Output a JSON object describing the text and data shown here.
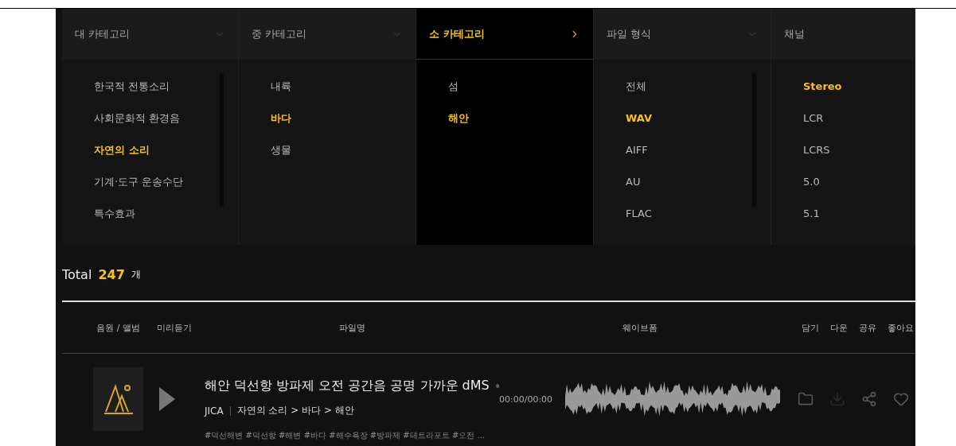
{
  "filters": [
    {
      "header": "대 카테고리",
      "selected": false,
      "kind": "dropdown",
      "scrollable": true,
      "items": [
        {
          "label": "한국적 전통소리",
          "selected": false
        },
        {
          "label": "사회문화적 환경음",
          "selected": false
        },
        {
          "label": "자연의 소리",
          "selected": true
        },
        {
          "label": "기계·도구 운송수단",
          "selected": false
        },
        {
          "label": "특수효과",
          "selected": false
        }
      ]
    },
    {
      "header": "중 카테고리",
      "selected": false,
      "kind": "dropdown",
      "scrollable": false,
      "items": [
        {
          "label": "내륙",
          "selected": false
        },
        {
          "label": "바다",
          "selected": true
        },
        {
          "label": "생물",
          "selected": false
        }
      ]
    },
    {
      "header": "소 카테고리",
      "selected": true,
      "kind": "dropdown",
      "scrollable": false,
      "items": [
        {
          "label": "섬",
          "selected": false
        },
        {
          "label": "해안",
          "selected": true
        }
      ]
    },
    {
      "header": "파일 형식",
      "selected": false,
      "kind": "dropdown",
      "scrollable": true,
      "items": [
        {
          "label": "전체",
          "selected": false
        },
        {
          "label": "WAV",
          "selected": true
        },
        {
          "label": "AIFF",
          "selected": false
        },
        {
          "label": "AU",
          "selected": false
        },
        {
          "label": "FLAC",
          "selected": false
        }
      ]
    },
    {
      "header": "채널",
      "selected": false,
      "kind": "plain",
      "scrollable": false,
      "items": [
        {
          "label": "Stereo",
          "selected": true
        },
        {
          "label": "LCR",
          "selected": false
        },
        {
          "label": "LCRS",
          "selected": false
        },
        {
          "label": "5.0",
          "selected": false
        },
        {
          "label": "5.1",
          "selected": false
        }
      ]
    }
  ],
  "total": {
    "label": "Total",
    "count": "247",
    "unit": "개"
  },
  "columns": {
    "album": "음원 / 앨범",
    "preview": "미리듣기",
    "filename": "파일명",
    "waveform": "웨이브폼",
    "actions": [
      "담기",
      "다운",
      "공유",
      "좋아요"
    ]
  },
  "rows": [
    {
      "title": "해안 덕선항 방파제 오전 공간음 공명 가까운 dMS",
      "artist": "JICA",
      "path": "자연의 소리 > 바다 > 해안",
      "tags": "#덕선해변 #덕선항 #해변 #바다 #해수욕장 #방파제 #테트라포트 #오전 ...",
      "time": "00:00/00:00"
    }
  ]
}
